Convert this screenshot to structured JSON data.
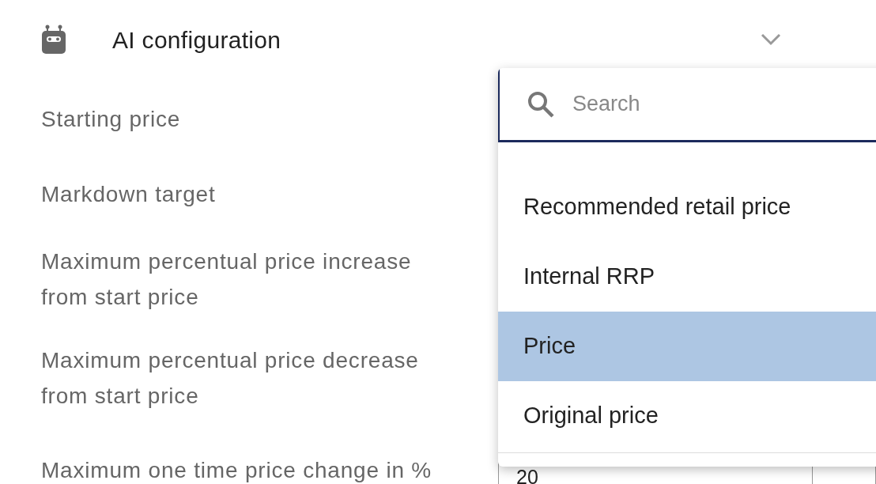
{
  "section": {
    "title": "AI configuration"
  },
  "fields": [
    {
      "label": "Starting price"
    },
    {
      "label": "Markdown target"
    },
    {
      "label": "Maximum percentual price increase from start price"
    },
    {
      "label": "Maximum percentual price decrease from start price"
    },
    {
      "label": "Maximum one time price change in %",
      "value": "20"
    }
  ],
  "dropdown": {
    "search": {
      "placeholder": "Search"
    },
    "options": [
      {
        "label": "Recommended retail price",
        "selected": false
      },
      {
        "label": "Internal RRP",
        "selected": false
      },
      {
        "label": "Price",
        "selected": true
      },
      {
        "label": "Original price",
        "selected": false
      }
    ]
  }
}
